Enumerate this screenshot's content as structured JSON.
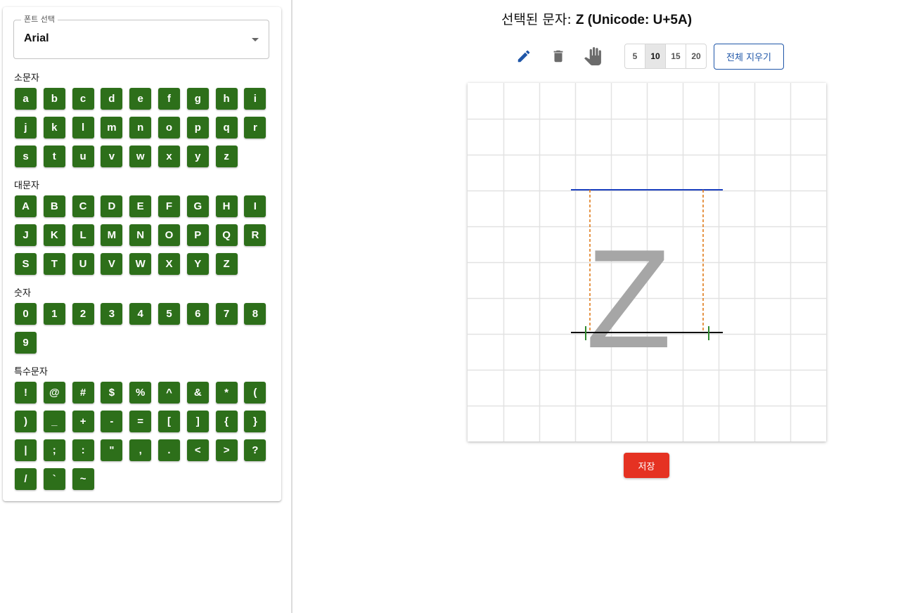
{
  "sidebar": {
    "font_select": {
      "label": "폰트 선택",
      "value": "Arial"
    },
    "sections": [
      {
        "label": "소문자",
        "chars": [
          "a",
          "b",
          "c",
          "d",
          "e",
          "f",
          "g",
          "h",
          "i",
          "j",
          "k",
          "l",
          "m",
          "n",
          "o",
          "p",
          "q",
          "r",
          "s",
          "t",
          "u",
          "v",
          "w",
          "x",
          "y",
          "z"
        ]
      },
      {
        "label": "대문자",
        "chars": [
          "A",
          "B",
          "C",
          "D",
          "E",
          "F",
          "G",
          "H",
          "I",
          "J",
          "K",
          "L",
          "M",
          "N",
          "O",
          "P",
          "Q",
          "R",
          "S",
          "T",
          "U",
          "V",
          "W",
          "X",
          "Y",
          "Z"
        ]
      },
      {
        "label": "숫자",
        "chars": [
          "0",
          "1",
          "2",
          "3",
          "4",
          "5",
          "6",
          "7",
          "8",
          "9"
        ]
      },
      {
        "label": "특수문자",
        "chars": [
          "!",
          "@",
          "#",
          "$",
          "%",
          "^",
          "&",
          "*",
          "(",
          ")",
          "_",
          "+",
          "-",
          "=",
          "[",
          "]",
          "{",
          "}",
          "|",
          ";",
          ":",
          "\"",
          ",",
          ".",
          "<",
          ">",
          "?",
          "/",
          "`",
          "~"
        ]
      }
    ]
  },
  "header": {
    "title_prefix": "선택된 문자: ",
    "selected_char": "Z",
    "title_suffix": " (Unicode: U+5A)"
  },
  "toolbar": {
    "icons": [
      "pencil-icon",
      "trash-icon",
      "hand-icon"
    ],
    "brush_sizes": [
      "5",
      "10",
      "15",
      "20"
    ],
    "selected_brush": "10",
    "clear_all_label": "전체 지우기"
  },
  "canvas": {
    "glyph": "Z",
    "grid_divisions": 10,
    "colors": {
      "ascender_line": "#1a3fbf",
      "baseline": "#000000",
      "advance_guides": "#e07b1a",
      "side_bearing_marks": "#2e8b2e",
      "glyph_fill": "#a6a6a6",
      "grid": "#e2e2e2"
    }
  },
  "footer": {
    "save_label": "저장"
  },
  "theme": {
    "char_button": "#2d6f1a",
    "primary": "#1f56a8",
    "danger": "#e53222"
  }
}
